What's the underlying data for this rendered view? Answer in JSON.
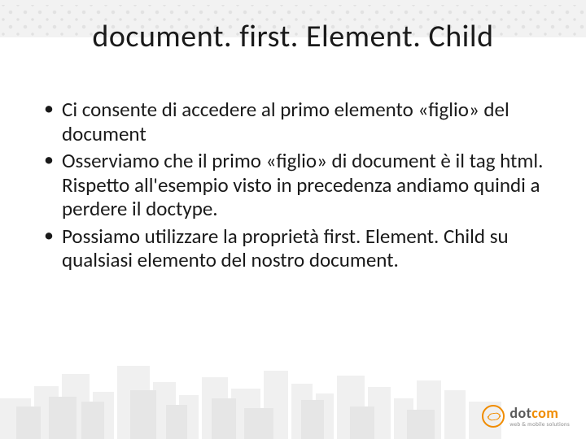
{
  "title": "document. first. Element. Child",
  "bullets": [
    "Ci consente di accedere al primo elemento «figlio» del document",
    "Osserviamo che il primo «figlio» di document è il tag html. Rispetto all'esempio visto in precedenza andiamo quindi a perdere il doctype.",
    "Possiamo utilizzare la proprietà first. Element. Child su qualsiasi elemento del nostro document."
  ],
  "logo": {
    "main_pre": "dot",
    "main_accent": "com",
    "sub": "web & mobile solutions"
  }
}
